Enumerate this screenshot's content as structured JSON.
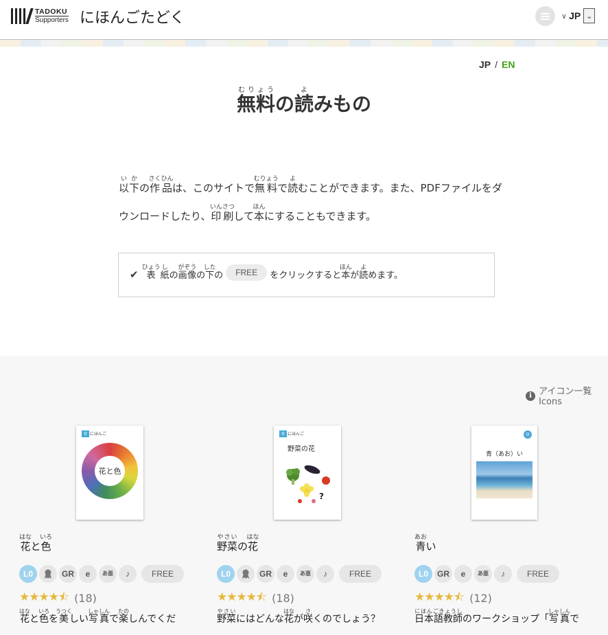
{
  "header": {
    "logo_line1": "TADOKU",
    "logo_line2": "Supporters",
    "site_name": "にほんごたどく",
    "lang_chevron": "∨",
    "lang_value": "JP",
    "lang_box": "⌄"
  },
  "lang_switch": {
    "jp": "JP",
    "sep": "/",
    "en": "EN"
  },
  "title": {
    "t1": "無料",
    "r1": "むりょう",
    "t2": "の",
    "t3": "読",
    "r3": "よ",
    "t4": "みもの"
  },
  "intro": {
    "a1": "以下",
    "a1r": "いか",
    "a2": "の",
    "a3": "作品",
    "a3r": "さくひん",
    "a4": "は、このサイトで",
    "a5": "無料",
    "a5r": "むりょう",
    "a6": "で",
    "a7": "読",
    "a7r": "よ",
    "a8": "むことができます。また、PDFファイルをダウンロードしたり、",
    "a9": "印刷",
    "a9r": "いんさつ",
    "a10": "して",
    "a11": "本",
    "a11r": "ほん",
    "a12": "にすることもできます。"
  },
  "note": {
    "n1": "表",
    "n1r": "ひょう",
    "n2": "紙",
    "n2r": "し",
    "n3": "の",
    "n4": "画像",
    "n4r": "がぞう",
    "n5": "の",
    "n6": "下",
    "n6r": "した",
    "n7": "の",
    "free": "FREE",
    "n8": "をクリックすると",
    "n9": "本",
    "n9r": "ほん",
    "n10": "が",
    "n11": "読",
    "n11r": "よ",
    "n12": "めます。"
  },
  "icons_link": {
    "info": "i",
    "line1": "アイコン一覧",
    "line2": "Icons"
  },
  "books": [
    {
      "cover_lv": "0",
      "cover_lv2": "にほんご",
      "cover_text": "花と色",
      "title_a": "花",
      "title_ar": "はな",
      "title_b": "と",
      "title_c": "色",
      "title_cr": "いろ",
      "badge_level": "L0",
      "badge_gr": "GR",
      "badge_e": "e",
      "badge_kana": "あ亜",
      "badge_music": "♪",
      "badge_free": "FREE",
      "stars": "★★★★⯪",
      "count": "(18)",
      "d1": "花",
      "d1r": "はな",
      "d2": "と",
      "d3": "色",
      "d3r": "いろ",
      "d4": "を",
      "d5": "美",
      "d5r": "うつく",
      "d6": "しい",
      "d7": "写真",
      "d7r": "しゃしん",
      "d8": "で",
      "d9": "楽",
      "d9r": "たの",
      "d10": "しんでくだ"
    },
    {
      "cover_lv": "0",
      "cover_lv2": "にほんご",
      "cover_text": "野菜の花",
      "title_a": "野菜",
      "title_ar": "やさい",
      "title_b": "の",
      "title_c": "花",
      "title_cr": "はな",
      "badge_level": "L0",
      "badge_gr": "GR",
      "badge_e": "e",
      "badge_kana": "あ亜",
      "badge_music": "♪",
      "badge_free": "FREE",
      "stars": "★★★★⯪",
      "count": "(18)",
      "d1": "野菜",
      "d1r": "やさい",
      "d2": "にはどんな",
      "d3": "花",
      "d3r": "はな",
      "d4": "が",
      "d5": "咲",
      "d5r": "さ",
      "d6": "くのでしょう？"
    },
    {
      "cover_lv": "0",
      "cover_text": "青（あお）い",
      "title_a": "青",
      "title_ar": "あお",
      "title_b": "い",
      "badge_level": "L0",
      "badge_gr": "GR",
      "badge_e": "e",
      "badge_kana": "あ亜",
      "badge_music": "♪",
      "badge_free": "FREE",
      "stars": "★★★★⯪",
      "count": "(12)",
      "d1": "日本語教師",
      "d1r": "にほんごきょうし",
      "d2": "のワークショップ「",
      "d3": "写真",
      "d3r": "しゃしん",
      "d4": "で"
    }
  ],
  "colors": {
    "accent_green": "#3fa10f",
    "level_blue": "#9fd3ef",
    "star": "#e6b83b"
  }
}
